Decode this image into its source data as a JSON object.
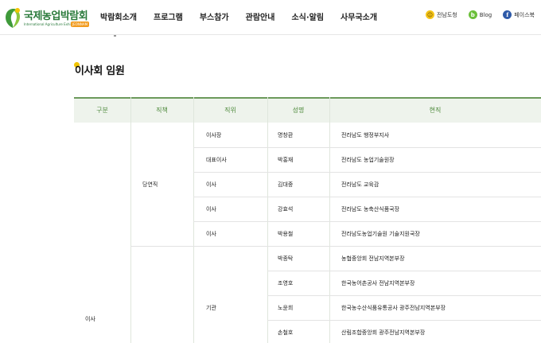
{
  "header": {
    "logo": {
      "title": "국제농업박람회",
      "subtitle": "International Agriculture Exhibition",
      "badge": "JEONNAM"
    },
    "nav": [
      "박람회소개",
      "프로그램",
      "부스참가",
      "관람안내",
      "소식·알림",
      "사무국소개"
    ],
    "sns": [
      {
        "label": "전남도청",
        "icon": "jeonnam-icon"
      },
      {
        "label": "Blog",
        "icon": "blog-icon"
      },
      {
        "label": "페이스북",
        "icon": "facebook-icon"
      }
    ]
  },
  "page": {
    "title": "이사회 임원"
  },
  "table": {
    "headers": [
      "구분",
      "직책",
      "직위",
      "성명",
      "현직"
    ],
    "group": "이사",
    "subgroups": [
      "당연직",
      "기관"
    ],
    "rows": [
      {
        "position": "이사장",
        "name": "명창환",
        "current": "전라남도 행정부지사"
      },
      {
        "position": "대표이사",
        "name": "박홍재",
        "current": "전라남도 농업기술원장"
      },
      {
        "position": "이사",
        "name": "김대중",
        "current": "전라남도 교육감"
      },
      {
        "position": "이사",
        "name": "강효석",
        "current": "전라남도 농축산식품국장"
      },
      {
        "position": "이사",
        "name": "박용철",
        "current": "전라남도농업기술원 기술지원국장"
      },
      {
        "position": "",
        "name": "박종탁",
        "current": "농협중앙회 전남지역본부장"
      },
      {
        "position": "",
        "name": "조영호",
        "current": "한국농어촌공사 전남지역본부장"
      },
      {
        "position": "기관",
        "name": "노윤희",
        "current": "한국농수산식품유통공사 광주전남지역본부장"
      },
      {
        "position": "",
        "name": "손철호",
        "current": "산림조합중앙회 광주전남지역본부장"
      }
    ]
  }
}
